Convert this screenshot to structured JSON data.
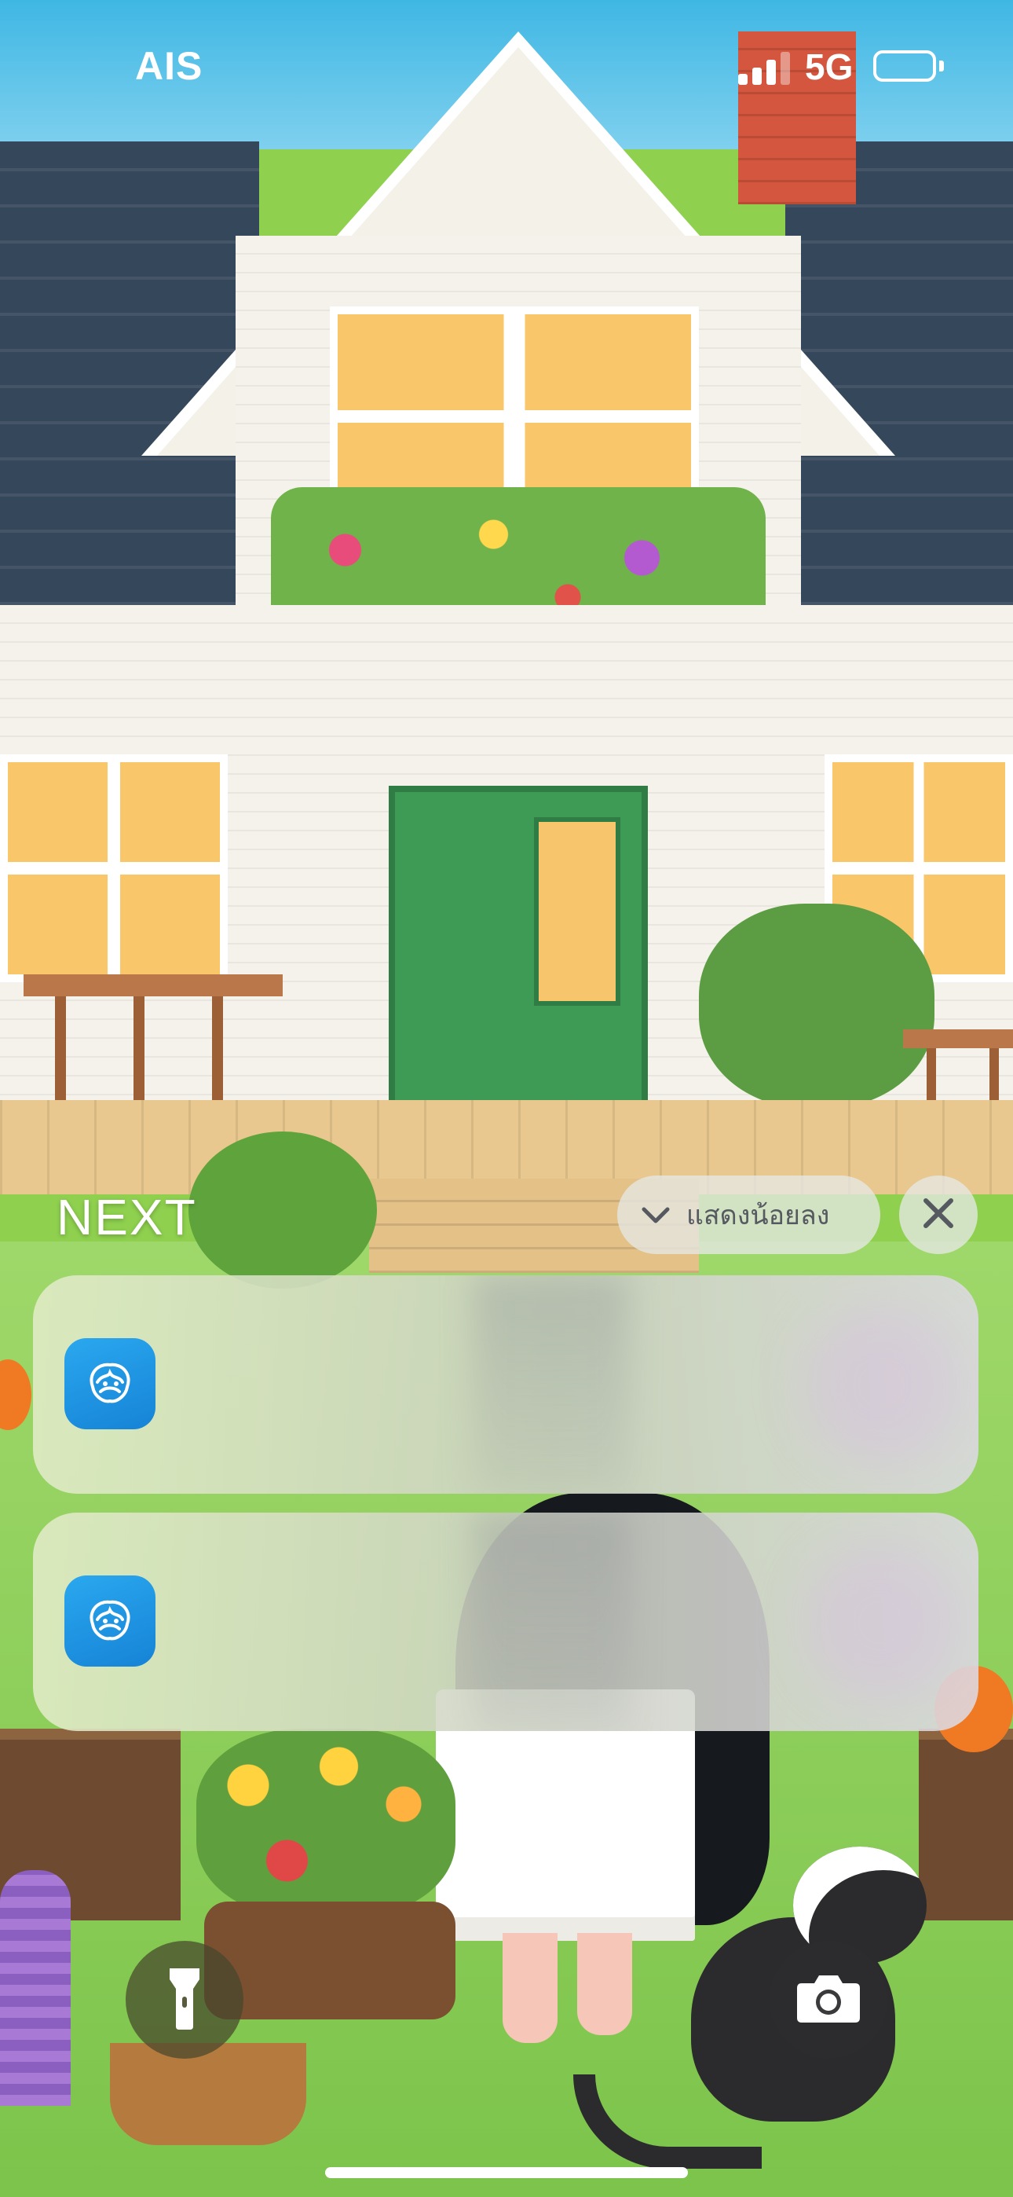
{
  "status_bar": {
    "carrier": "AIS",
    "network": "5G",
    "signal_bars": 4,
    "signal_bars_filled": 3
  },
  "notification_center": {
    "section_title": "NEXT",
    "show_less_label": "แสดงน้อยลง",
    "show_less_icon": "chevron-down-icon",
    "close_icon": "close-icon",
    "notifications": [
      {
        "app_icon": "krungthai-app-icon",
        "content_hidden": true
      },
      {
        "app_icon": "krungthai-app-icon",
        "content_hidden": true
      }
    ]
  },
  "bottom_controls": {
    "flashlight_icon": "flashlight-icon",
    "camera_icon": "camera-icon"
  },
  "colors": {
    "app_icon_accent": "#1E96E6",
    "status_text": "#FFFFFF"
  }
}
